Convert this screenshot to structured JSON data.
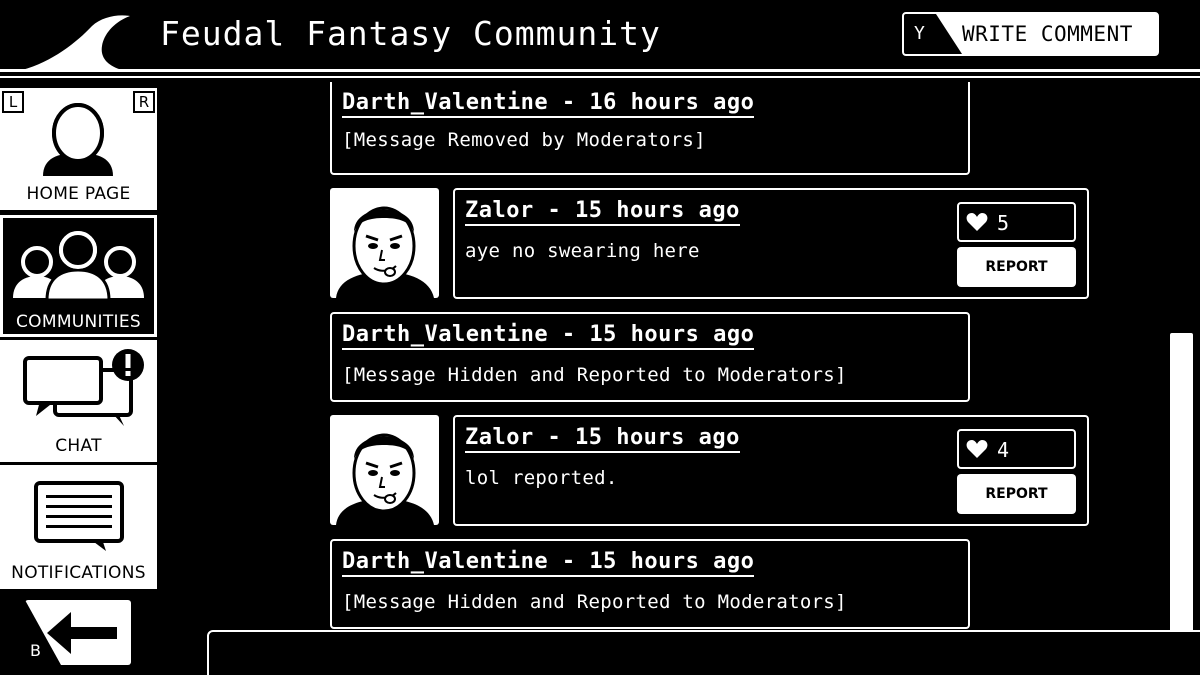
{
  "header": {
    "title": "Feudal Fantasy Community",
    "write_button": {
      "key": "Y",
      "label": "WRITE COMMENT"
    }
  },
  "sidebar": {
    "shoulder_left": "L",
    "shoulder_right": "R",
    "items": [
      {
        "label": "HOME PAGE",
        "icon": "person-icon",
        "selected": false
      },
      {
        "label": "COMMUNITIES",
        "icon": "group-icon",
        "selected": true
      },
      {
        "label": "CHAT",
        "icon": "chat-alert-icon",
        "selected": false
      },
      {
        "label": "NOTIFICATIONS",
        "icon": "message-list-icon",
        "selected": false
      }
    ],
    "back": {
      "key": "B",
      "icon": "back-arrow-icon"
    }
  },
  "feed": {
    "messages": [
      {
        "author": "Darth_Valentine",
        "time": "16 hours ago",
        "header": "Darth_Valentine - 16 hours ago",
        "text": "[Message Removed by Moderators]"
      },
      {
        "author": "Zalor",
        "time": "15 hours ago",
        "header": "Zalor - 15 hours ago",
        "text": "aye no swearing here",
        "likes": "5",
        "report_label": "REPORT"
      },
      {
        "author": "Darth_Valentine",
        "time": "15 hours ago",
        "header": "Darth_Valentine - 15 hours ago",
        "text": "[Message Hidden and Reported to Moderators]"
      },
      {
        "author": "Zalor",
        "time": "15 hours ago",
        "header": "Zalor - 15 hours ago",
        "text": "lol reported.",
        "likes": "4",
        "report_label": "REPORT"
      },
      {
        "author": "Darth_Valentine",
        "time": "15 hours ago",
        "header": "Darth_Valentine - 15 hours ago",
        "text": "[Message Hidden and Reported to Moderators]"
      }
    ]
  },
  "colors": {
    "background": "#000000",
    "foreground": "#ffffff"
  }
}
